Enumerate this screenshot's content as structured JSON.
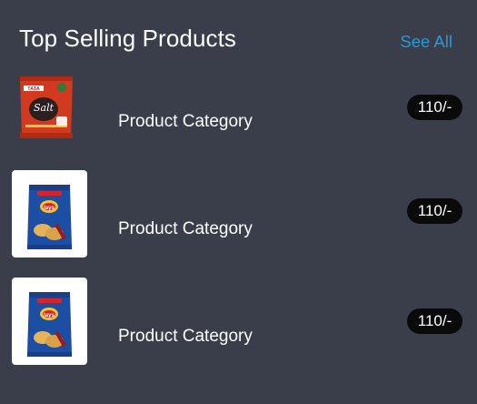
{
  "header": {
    "title": "Top Selling Products",
    "see_all": "See All"
  },
  "products": [
    {
      "category": "Product Category",
      "price": "110/-",
      "image": "tata-salt-pack"
    },
    {
      "category": "Product Category",
      "price": "110/-",
      "image": "lays-chips-pack"
    },
    {
      "category": "Product Category",
      "price": "110/-",
      "image": "lays-chips-pack"
    }
  ],
  "colors": {
    "background": "#3a3e4b",
    "link": "#2a97d8",
    "price_badge": "#0a0a0a"
  }
}
